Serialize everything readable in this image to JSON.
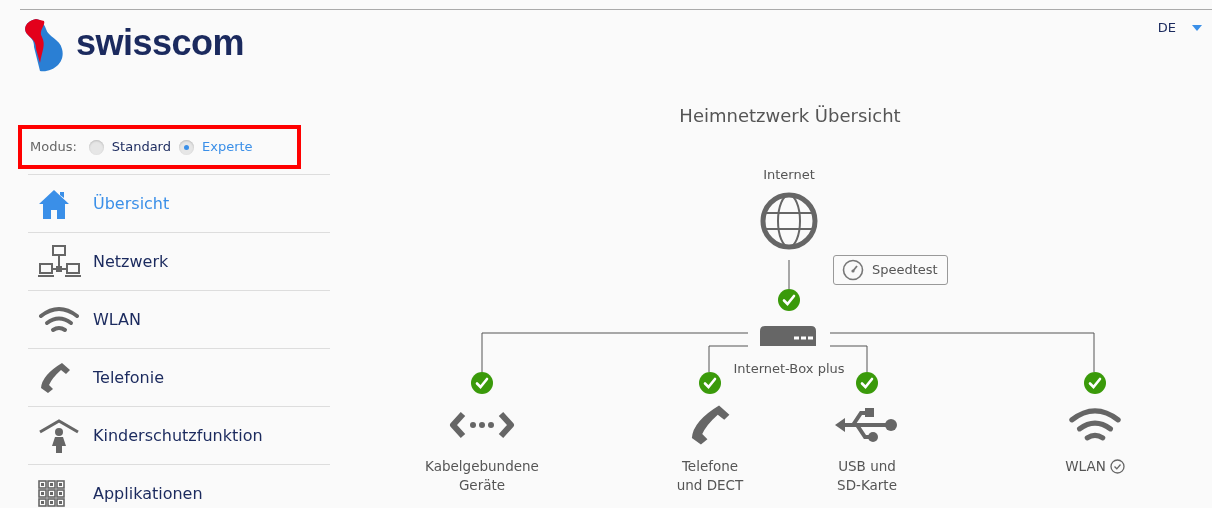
{
  "logo": {
    "text": "swisscom"
  },
  "language": {
    "label": "DE"
  },
  "mode": {
    "label": "Modus:",
    "options": [
      {
        "label": "Standard",
        "selected": false
      },
      {
        "label": "Experte",
        "selected": true
      }
    ]
  },
  "sidebar": {
    "items": [
      {
        "label": "Übersicht",
        "kind": "home",
        "selected": true
      },
      {
        "label": "Netzwerk",
        "kind": "network",
        "selected": false
      },
      {
        "label": "WLAN",
        "kind": "wifi",
        "selected": false
      },
      {
        "label": "Telefonie",
        "kind": "phone",
        "selected": false
      },
      {
        "label": "Kinderschutzfunktion",
        "kind": "child",
        "selected": false
      },
      {
        "label": "Applikationen",
        "kind": "apps",
        "selected": false
      }
    ]
  },
  "overview": {
    "title": "Heimnetzwerk Übersicht",
    "internet": {
      "label": "Internet",
      "connected": true
    },
    "speedtest": {
      "label": "Speedtest"
    },
    "router": {
      "label": "Internet-Box plus"
    },
    "devices": [
      {
        "lines": [
          "Kabelgebundene",
          "Geräte"
        ],
        "kind": "wired",
        "connected": true
      },
      {
        "lines": [
          "Telefone",
          "und DECT"
        ],
        "kind": "phone",
        "connected": true
      },
      {
        "lines": [
          "USB und",
          "SD-Karte"
        ],
        "kind": "usb",
        "connected": true
      },
      {
        "lines": [
          "WLAN"
        ],
        "kind": "wifi",
        "connected": true,
        "info": true
      }
    ]
  }
}
